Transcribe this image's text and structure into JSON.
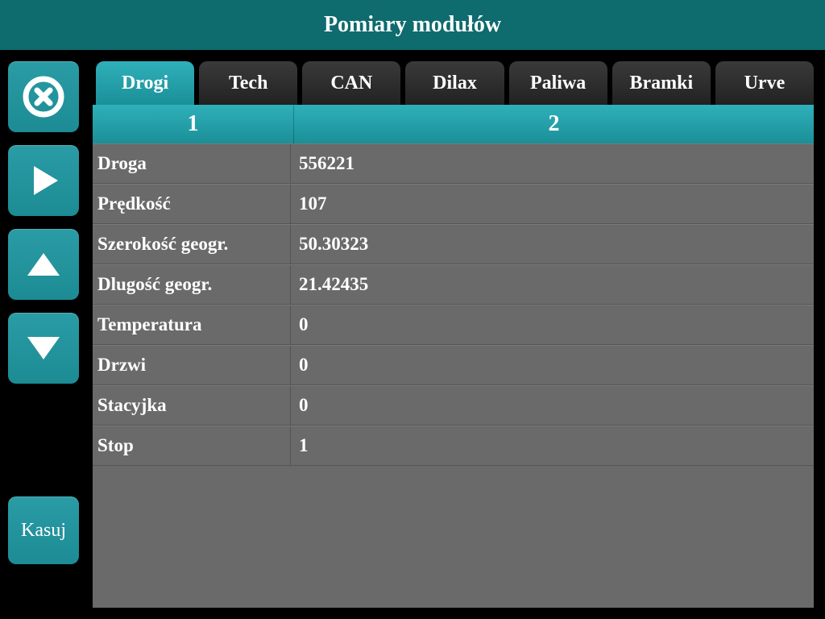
{
  "header": {
    "title": "Pomiary modułów"
  },
  "sidebar": {
    "kasuj_label": "Kasuj"
  },
  "tabs": [
    {
      "label": "Drogi",
      "active": true
    },
    {
      "label": "Tech",
      "active": false
    },
    {
      "label": "CAN",
      "active": false
    },
    {
      "label": "Dilax",
      "active": false
    },
    {
      "label": "Paliwa",
      "active": false
    },
    {
      "label": "Bramki",
      "active": false
    },
    {
      "label": "Urve",
      "active": false
    }
  ],
  "subtabs": [
    {
      "label": "1"
    },
    {
      "label": "2"
    }
  ],
  "rows": [
    {
      "label": "Droga",
      "value": "556221"
    },
    {
      "label": "Prędkość",
      "value": "107"
    },
    {
      "label": "Szerokość geogr.",
      "value": "50.30323"
    },
    {
      "label": "Dlugość geogr.",
      "value": "21.42435"
    },
    {
      "label": "Temperatura",
      "value": "0"
    },
    {
      "label": "Drzwi",
      "value": "0"
    },
    {
      "label": "Stacyjka",
      "value": "0"
    },
    {
      "label": "Stop",
      "value": "1"
    }
  ]
}
